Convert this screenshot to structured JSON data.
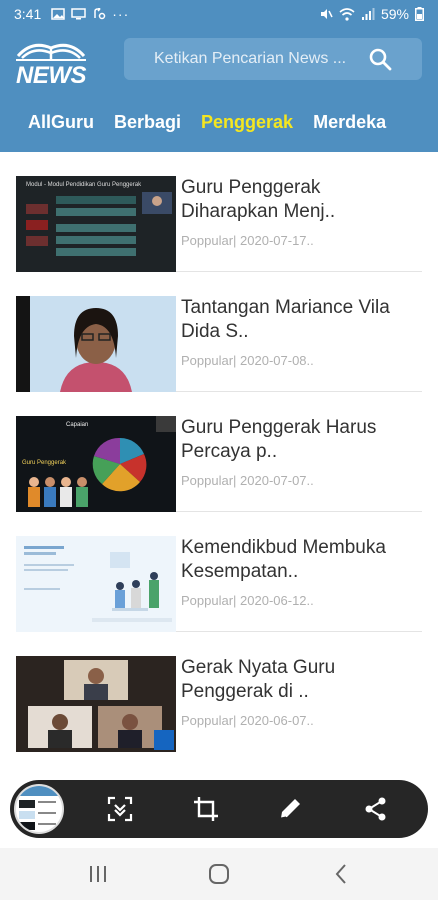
{
  "status_bar": {
    "time": "3:41",
    "notifications": [
      "gallery-icon",
      "monitor-icon",
      "data-saver-icon"
    ],
    "more": "···",
    "battery_percent": "59%",
    "icons": [
      "mute-icon",
      "wifi-icon",
      "signal-icon",
      "battery-icon"
    ]
  },
  "header": {
    "logo_text": "NEWS",
    "search_placeholder": "Ketikan Pencarian News ..."
  },
  "tabs": [
    {
      "label": "AllGuru",
      "active": false
    },
    {
      "label": "Berbagi",
      "active": false
    },
    {
      "label": "Penggerak",
      "active": true
    },
    {
      "label": "Merdeka",
      "active": false
    }
  ],
  "news": [
    {
      "title": "Guru Penggerak Diharapkan Menj..",
      "meta": "Poppular| 2020-07-17..",
      "thumb_caption": "Modul - Modul Pendidikan Guru Penggerak"
    },
    {
      "title": "Tantangan Mariance Vila Dida S..",
      "meta": "Poppular| 2020-07-08.."
    },
    {
      "title": "Guru Penggerak Harus Percaya p..",
      "meta": "Poppular| 2020-07-07..",
      "thumb_caption": "Capaian",
      "thumb_caption_2": "Guru Penggerak"
    },
    {
      "title": "Kemendikbud Membuka Kesempatan..",
      "meta": "Poppular| 2020-06-12.."
    },
    {
      "title": "Gerak Nyata Guru Penggerak di ..",
      "meta": "Poppular| 2020-06-07.."
    }
  ],
  "toolbar": {
    "buttons": [
      "scroll-capture-icon",
      "crop-icon",
      "draw-icon",
      "share-icon"
    ]
  },
  "nav": {
    "buttons": [
      "recent-apps-icon",
      "home-icon",
      "back-icon"
    ]
  },
  "colors": {
    "header_blue": "#4f8fc0",
    "active_tab": "#f4e620",
    "title_text": "#333333",
    "meta_text": "#b0b0b0"
  }
}
